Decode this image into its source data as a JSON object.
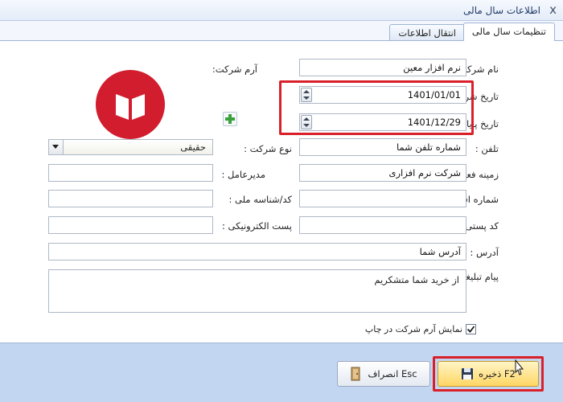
{
  "window": {
    "title": "اطلاعات سال مالی",
    "close_glyph": "x"
  },
  "tabs": [
    {
      "label": "تنظیمات سال مالی",
      "active": true
    },
    {
      "label": "انتقال اطلاعات",
      "active": false
    }
  ],
  "form": {
    "company_name": {
      "label": "نام شرکت :",
      "value": "نرم افزار معین"
    },
    "start_date": {
      "label": "تاریخ شروع :",
      "value": "1401/01/01"
    },
    "end_date": {
      "label": "تاریخ پایان :",
      "value": "1401/12/29"
    },
    "phone": {
      "label": "تلفن :",
      "value": "شماره تلفن شما"
    },
    "activity": {
      "label": "زمینه فعالیت :",
      "value": "شرکت نرم افزاری"
    },
    "economic_number": {
      "label": "شماره اقتصادی :",
      "value": ""
    },
    "postal_code": {
      "label": "کد پستی :",
      "value": ""
    },
    "address": {
      "label": "آدرس :",
      "value": "آدرس شما"
    },
    "ad_message": {
      "label": "پیام تبلیغاتی :",
      "value": "از خرید شما متشکریم"
    },
    "company_logo": {
      "label": "آرم شرکت:"
    },
    "company_type": {
      "label": "نوع شرکت :",
      "value": "حقیقی"
    },
    "ceo": {
      "label": "مدیرعامل :",
      "value": ""
    },
    "national_id": {
      "label": "کد/شناسه ملی :",
      "value": ""
    },
    "email": {
      "label": "پست الکترونیکی :",
      "value": ""
    },
    "show_logo_in_print": {
      "label": "نمایش آرم شرکت در چاپ",
      "checked": true
    }
  },
  "buttons": {
    "save": {
      "label": "F2 ذخیره"
    },
    "cancel": {
      "label": "Esc انصراف"
    }
  },
  "colors": {
    "highlight": "#d9202a",
    "logo": "#d11d2e",
    "save_bg": "#ffd663"
  }
}
